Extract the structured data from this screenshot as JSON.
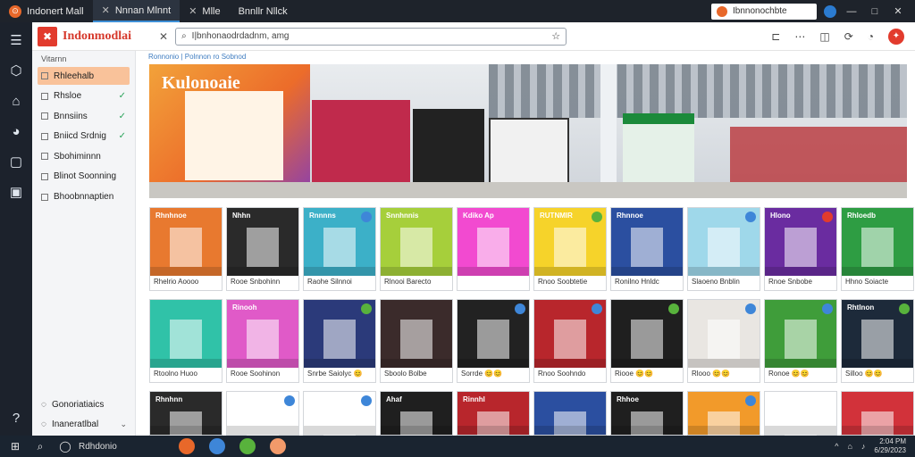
{
  "window": {
    "tabs": [
      {
        "label": "Indonert Mall",
        "active": false
      },
      {
        "label": "Nnnan Mlnnt",
        "active": true
      },
      {
        "label": "Mlle",
        "active": false
      },
      {
        "label": "Bnnllr Nllck",
        "active": false
      }
    ],
    "search_text": "Ibnnonochbte",
    "controls": [
      "—",
      "□",
      "✕"
    ]
  },
  "browser": {
    "brand": "Indonmodlai",
    "address": "I|bnhonaodrdadnm, amg",
    "icons": [
      "tabs-icon",
      "more-icon",
      "shield-icon",
      "sync-icon",
      "extensions-icon",
      "profile-icon"
    ]
  },
  "sidebar": {
    "header": "Vitarnn",
    "items": [
      {
        "label": "Rhleehalb",
        "active": true,
        "checked": false
      },
      {
        "label": "Rhsloe",
        "active": false,
        "checked": true
      },
      {
        "label": "Bnnsiins",
        "active": false,
        "checked": true
      },
      {
        "label": "Bniicd Srdnig",
        "active": false,
        "checked": true
      },
      {
        "label": "Sbohiminnn",
        "active": false,
        "checked": false
      },
      {
        "label": "Blinot Soonning",
        "active": false,
        "checked": false
      },
      {
        "label": "Bhoobnnaptien",
        "active": false,
        "checked": false
      }
    ],
    "footer": [
      {
        "label": "Gonoriatiaics"
      },
      {
        "label": "Inaneratlbal"
      }
    ]
  },
  "content": {
    "breadcrumb": "Ronnonio | Polnnon ro Sobnod",
    "hero_sign": "Kulonoaie",
    "tiles_row1": [
      {
        "caption": "Rhelrio Aoooo",
        "sign": "Rhnhnoe",
        "bg": "#e8792f",
        "badge": ""
      },
      {
        "caption": "Rooe Snbohinn",
        "sign": "Nhhn",
        "bg": "#2a2a2a",
        "badge": ""
      },
      {
        "caption": "Raohe Silnnoi",
        "sign": "Rnnnns",
        "bg": "#3cb0c8",
        "badge": "#3e86d8"
      },
      {
        "caption": "Rlnooi Barecto",
        "sign": "Snnhnnis",
        "bg": "#a6cf3b",
        "badge": ""
      },
      {
        "caption": "",
        "sign": "Kdiko Ap",
        "bg": "#f24ad0",
        "badge": ""
      },
      {
        "caption": "Rnoo Soobtetie",
        "sign": "RUTNMIR",
        "bg": "#f6d32a",
        "badge": "#58b23c"
      },
      {
        "caption": "Ronilno Hnldc",
        "sign": "Rhnnoe",
        "bg": "#2b4fa0",
        "badge": ""
      },
      {
        "caption": "Slaoeno Bnblin",
        "sign": "",
        "bg": "#9fd8ea",
        "badge": "#3e86d8"
      },
      {
        "caption": "Rnoe Snbobe",
        "sign": "Hlono",
        "bg": "#6a2ca0",
        "badge": "#e23b2d"
      },
      {
        "caption": "Hhno Soiacte",
        "sign": "Rhloedb",
        "bg": "#2e9d43",
        "badge": ""
      }
    ],
    "tiles_row2": [
      {
        "caption": "Rtoolno Huoo",
        "sign": "",
        "bg": "#30c2a8",
        "badge": ""
      },
      {
        "caption": "Rooe Soohinon",
        "sign": "Rinooh",
        "bg": "#e05ac8",
        "badge": ""
      },
      {
        "caption": "Snrbe Saiolyc 😊",
        "sign": "",
        "bg": "#2b3a7a",
        "badge": "#58b23c"
      },
      {
        "caption": "Sboolo Bolbe",
        "sign": "",
        "bg": "#3b2b2b",
        "badge": ""
      },
      {
        "caption": "Sorrde 😊😊",
        "sign": "",
        "bg": "#222",
        "badge": "#3e86d8"
      },
      {
        "caption": "Rnoo Soohndo",
        "sign": "",
        "bg": "#b8262c",
        "badge": "#3e86d8"
      },
      {
        "caption": "Riooe 😊😊",
        "sign": "",
        "bg": "#1f1f1f",
        "badge": "#58b23c"
      },
      {
        "caption": "Rlooo 😊😊",
        "sign": "",
        "bg": "#e9e6e2",
        "badge": "#3e86d8"
      },
      {
        "caption": "Ronoe 😊😊",
        "sign": "",
        "bg": "#3f9d3a",
        "badge": "#3e86d8"
      },
      {
        "caption": "Silloo 😊😊",
        "sign": "Rhtlnon",
        "bg": "#1d2a3a",
        "badge": "#58b23c"
      }
    ],
    "tiles_row3": [
      {
        "sign": "Rhnhnn",
        "bg": "#2a2a2a",
        "badge": ""
      },
      {
        "sign": "",
        "bg": "#ffffff",
        "badge": "#3e86d8"
      },
      {
        "sign": "",
        "bg": "#ffffff",
        "badge": "#3e86d8"
      },
      {
        "sign": "Ahaf",
        "bg": "#1f1f1f",
        "badge": ""
      },
      {
        "sign": "Rinnhl",
        "bg": "#b8262c",
        "badge": ""
      },
      {
        "sign": "",
        "bg": "#2b4fa0",
        "badge": ""
      },
      {
        "sign": "Rhhoe",
        "bg": "#1f1f1f",
        "badge": ""
      },
      {
        "sign": "",
        "bg": "#f29a2a",
        "badge": "#3e86d8"
      },
      {
        "sign": "",
        "bg": "#ffffff",
        "badge": ""
      },
      {
        "sign": "",
        "bg": "#d2323a",
        "badge": ""
      }
    ]
  },
  "taskbar": {
    "search_label": "Rdhdonio",
    "tray_time": "2:04 PM",
    "tray_date": "6/29/2023",
    "app_colors": [
      "#e8682a",
      "#3e86d8",
      "#58b23c",
      "#f29a6a"
    ]
  },
  "colors": {
    "accent": "#e23b2d",
    "sidebar_active": "#f9c29a",
    "link": "#3e7cc0"
  }
}
